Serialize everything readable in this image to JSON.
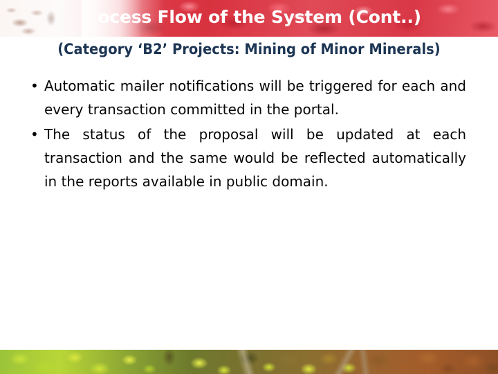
{
  "slide": {
    "title": {
      "full_text": "Process Flow of the System (Cont..)",
      "visible_text": "ocess  Flow of the System (Cont..)",
      "obscured_prefix": "Pr",
      "color": "#ffffff"
    },
    "subtitle": {
      "text": "(Category ‘B2’ Projects: Mining of Minor Minerals)",
      "color": "#1c3553"
    },
    "bullets": [
      {
        "marker": "•",
        "text": "Automatic mailer notifications will be triggered for each and every transaction committed in the portal."
      },
      {
        "marker": "•",
        "text": "The status of the proposal will be updated at each transaction and the same would be reflected automatically in the reports available in public domain."
      }
    ],
    "decorations": {
      "top_band": {
        "name": "red-maple-leaves-banner",
        "primary_color": "#de3f4c",
        "accent_color": "#f0828c",
        "washout_color": "#fbf6f4"
      },
      "bottom_band": {
        "name": "autumn-leaves-banner",
        "left_color": "#b9d636",
        "mid_color": "#8a6f30",
        "right_color": "#a35c2a"
      }
    },
    "background_color": "#ffffff"
  }
}
